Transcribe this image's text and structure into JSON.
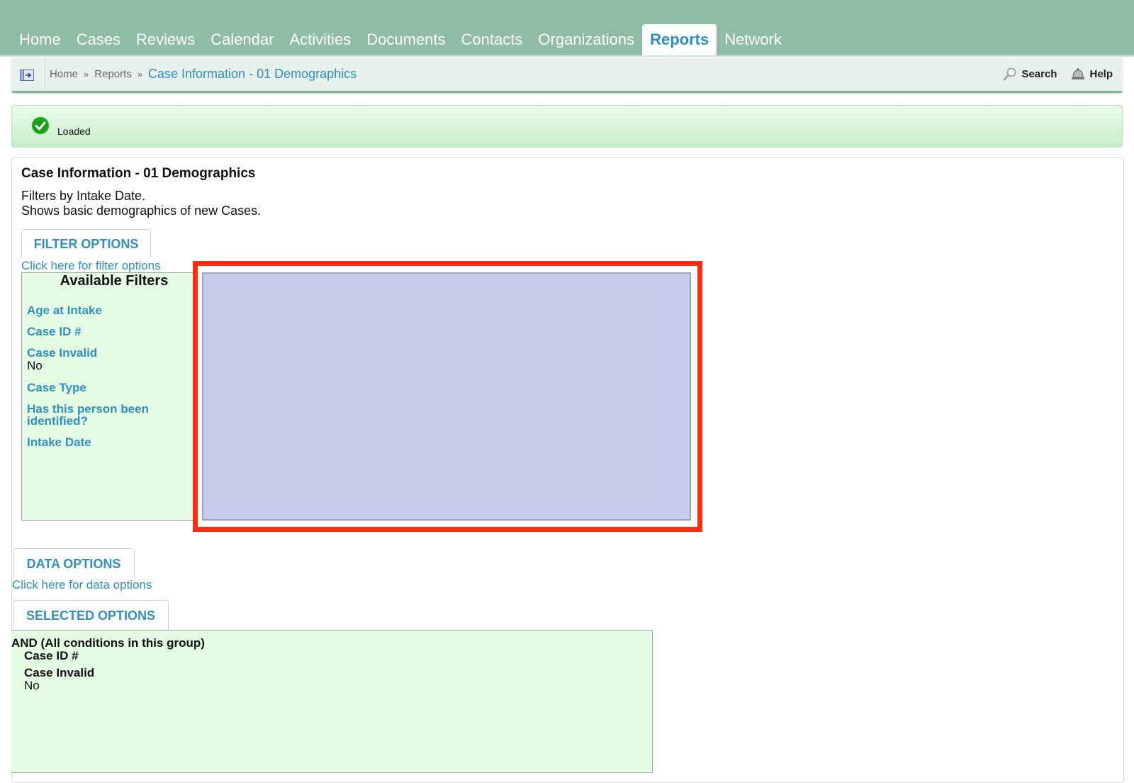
{
  "nav": {
    "tabs": [
      {
        "label": "Home"
      },
      {
        "label": "Cases"
      },
      {
        "label": "Reviews"
      },
      {
        "label": "Calendar"
      },
      {
        "label": "Activities"
      },
      {
        "label": "Documents"
      },
      {
        "label": "Contacts"
      },
      {
        "label": "Organizations"
      },
      {
        "label": "Reports",
        "active": true
      },
      {
        "label": "Network"
      }
    ]
  },
  "breadcrumb": {
    "items": [
      "Home",
      "Reports"
    ],
    "separator": "»",
    "current": "Case Information - 01 Demographics"
  },
  "header_actions": {
    "search_label": "Search",
    "help_label": "Help"
  },
  "status": {
    "message": "Loaded"
  },
  "report": {
    "title": "Case Information - 01 Demographics",
    "description_line1": "Filters by Intake Date.",
    "description_line2": "Shows basic demographics of new Cases."
  },
  "filter_options": {
    "tab_label": "FILTER OPTIONS",
    "link": "Click here for filter options",
    "available_heading": "Available Filters",
    "filters": [
      {
        "label": "Age at Intake",
        "value": ""
      },
      {
        "label": "Case ID #",
        "value": ""
      },
      {
        "label": "Case Invalid",
        "value": "No"
      },
      {
        "label": "Case Type",
        "value": ""
      },
      {
        "label": "Has this person been identified?",
        "value": ""
      },
      {
        "label": "Intake Date",
        "value": ""
      }
    ]
  },
  "data_options": {
    "tab_label": "DATA OPTIONS",
    "link": "Click here for data options"
  },
  "selected_options": {
    "tab_label": "SELECTED OPTIONS",
    "group_label": "AND (All conditions in this group)",
    "items": [
      {
        "label": "Case ID #",
        "value": ""
      },
      {
        "label": "Case Invalid",
        "value": "No"
      }
    ]
  },
  "colors": {
    "nav_bg": "#8fbca5",
    "accent": "#2f8fc0",
    "highlight": "#ff2d12",
    "dropzone": "#c8cdee",
    "panel_green": "#e4fbe4"
  }
}
